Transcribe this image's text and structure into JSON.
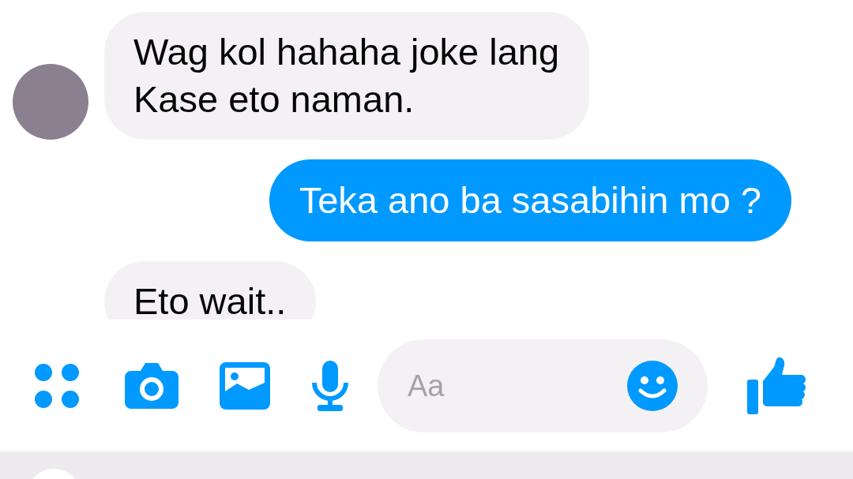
{
  "messages": [
    {
      "outgoing": false,
      "text": "Wag kol hahaha joke lang\nKase eto naman.",
      "avatar": true
    },
    {
      "outgoing": true,
      "text": "Teka ano ba sasabihin mo ?",
      "avatar": false
    },
    {
      "outgoing": false,
      "text": "Eto wait..",
      "avatar": false
    }
  ],
  "composer": {
    "placeholder": "Aa"
  }
}
